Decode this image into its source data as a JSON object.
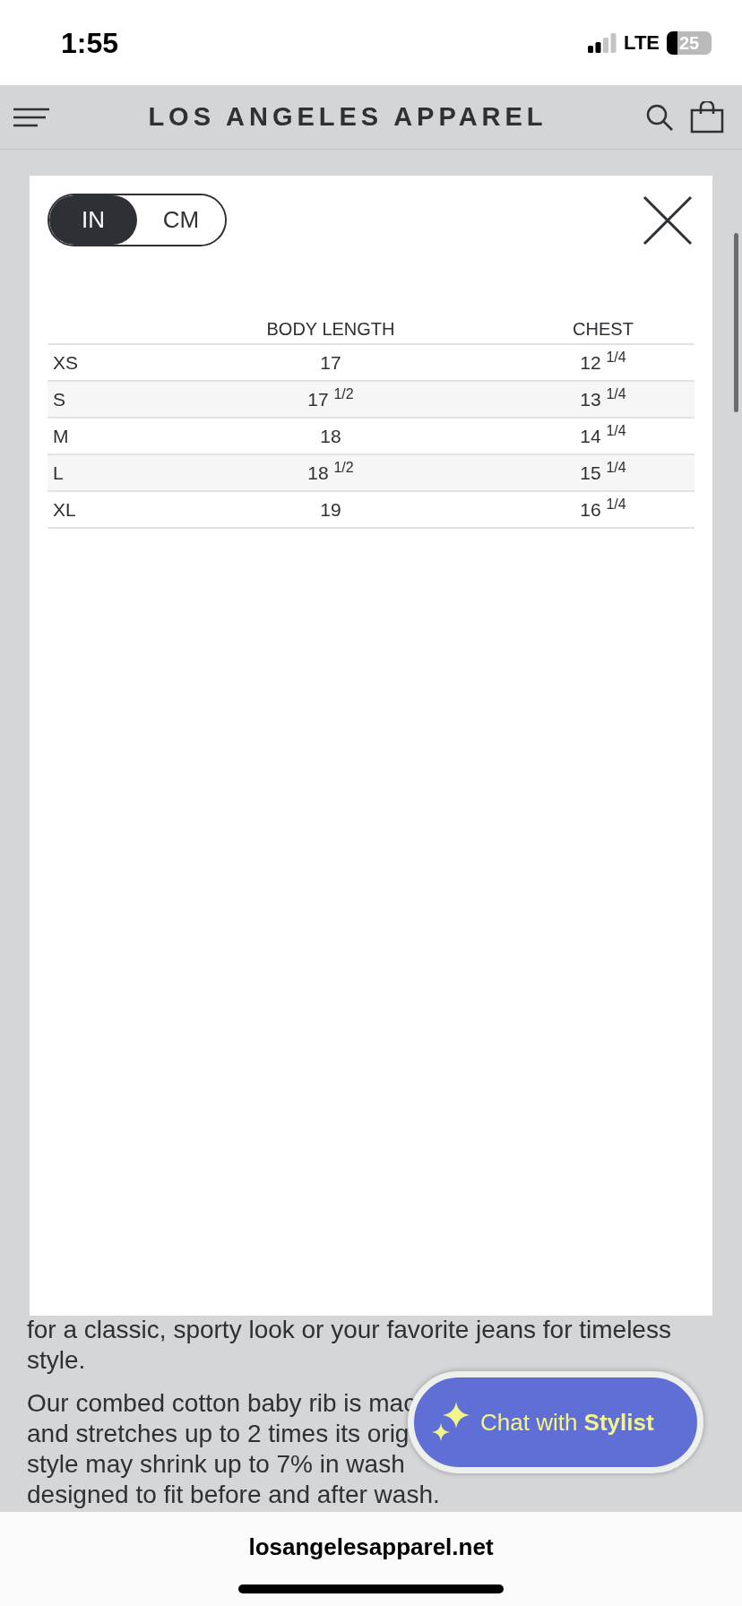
{
  "status_bar": {
    "time": "1:55",
    "network": "LTE",
    "battery": "25"
  },
  "header": {
    "brand": "LOS ANGELES APPAREL"
  },
  "page": {
    "paragraphs": [
      {
        "lines": [
          "for a classic, sporty look or your favorite jeans for timeless",
          "style."
        ]
      },
      {
        "lines": [
          "Our combed cotton baby rib is mac",
          "and stretches up to 2 times its orig",
          "style may shrink up to 7% in wash",
          "designed to fit before and after wash."
        ]
      }
    ]
  },
  "size_chart": {
    "units": [
      {
        "label": "IN",
        "selected": true
      },
      {
        "label": "CM",
        "selected": false
      }
    ],
    "columns": [
      "BODY LENGTH",
      "CHEST"
    ],
    "rows": [
      {
        "size": "XS",
        "body_length": "17",
        "chest": "12 $^{1/4}$"
      },
      {
        "size": "S",
        "body_length": "17 $^{1/2}$",
        "chest": "13 $^{1/4}$"
      },
      {
        "size": "M",
        "body_length": "18",
        "chest": "14 $^{1/4}$"
      },
      {
        "size": "L",
        "body_length": "18 $^{1/2}$",
        "chest": "15 $^{1/4}$"
      },
      {
        "size": "XL",
        "body_length": "19",
        "chest": "16 $^{1/4}$"
      }
    ]
  },
  "chat_button": {
    "label": "Chat with **Stylist**"
  },
  "browser": {
    "url": "losangelesapparel.net"
  }
}
